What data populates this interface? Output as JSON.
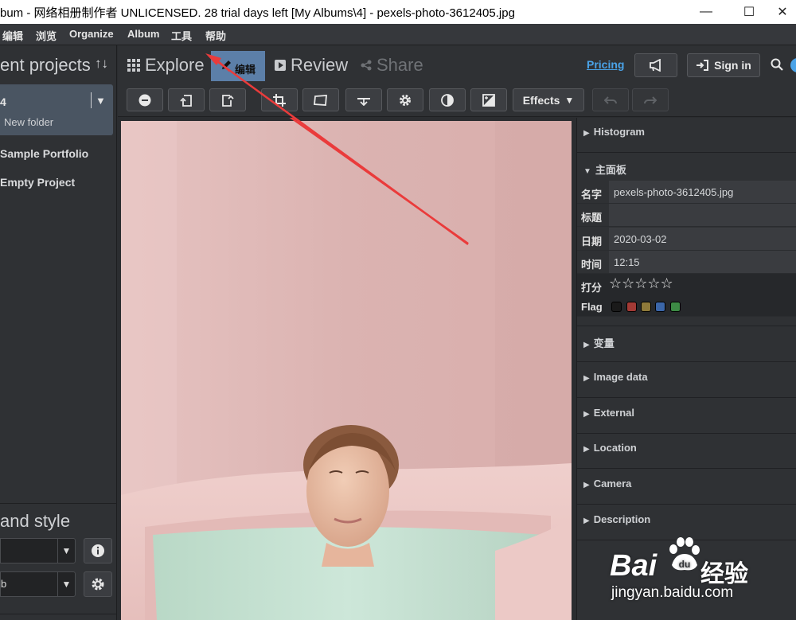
{
  "window": {
    "title": "bum - 网络相册制作者 UNLICENSED. 28 trial days left [My Albums\\4] - pexels-photo-3612405.jpg",
    "minimize": "—",
    "maximize": "☐",
    "close": "✕"
  },
  "menu": [
    "编辑",
    "浏览",
    "Organize",
    "Album",
    "工具",
    "帮助"
  ],
  "left": {
    "projects_header": "ent projects",
    "sort_icon": "↑↓",
    "current_project": "4",
    "current_folder": "New folder",
    "projects": [
      "Sample Portfolio",
      "Empty Project"
    ],
    "style_header": "and style",
    "select1_value": "",
    "select2_value": "b"
  },
  "modes": {
    "explore": "Explore",
    "edit": "编辑",
    "review": "Review",
    "share": "Share"
  },
  "top": {
    "pricing": "Pricing",
    "signin": "Sign in"
  },
  "toolbar": {
    "effects": "Effects",
    "effects_caret": "▼"
  },
  "panel": {
    "histogram": "Histogram",
    "main": "主面板",
    "fields": [
      {
        "key": "名字",
        "value": "pexels-photo-3612405.jpg"
      },
      {
        "key": "标题",
        "value": ""
      },
      {
        "key": "日期",
        "value": "2020-03-02"
      },
      {
        "key": "时间",
        "value": "12:15"
      }
    ],
    "rating_label": "打分",
    "rating_stars": "☆☆☆☆☆",
    "flag_label": "Flag",
    "flag_colors": [
      "#1a1a1a",
      "#a33a35",
      "#8f7a3a",
      "#3b66a8",
      "#3d8a45"
    ],
    "sections": [
      "变量",
      "Image data",
      "External",
      "Location",
      "Camera",
      "Description"
    ]
  },
  "watermark": {
    "brand": "Bai",
    "brand_cn": "经验",
    "url": "jingyan.baidu.com"
  }
}
